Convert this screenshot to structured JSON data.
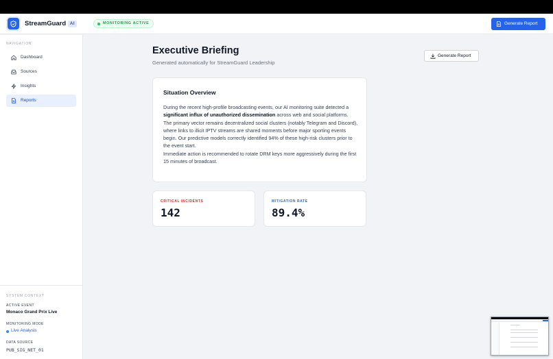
{
  "app": {
    "brand": "StreamGuard",
    "ai_badge": "AI",
    "status_pill": "MONITORING ACTIVE",
    "primary_button": "Generate Report",
    "accent_color": "#2563eb"
  },
  "sidebar": {
    "heading": "NAVIGATION",
    "items": [
      {
        "label": "Dashboard",
        "icon": "home-icon",
        "active": false
      },
      {
        "label": "Sources",
        "icon": "database-icon",
        "active": false
      },
      {
        "label": "Insights",
        "icon": "lightning-icon",
        "active": false
      },
      {
        "label": "Reports",
        "icon": "document-icon",
        "active": true
      }
    ],
    "context": {
      "heading": "SYSTEM CONTEXT",
      "active_event_label": "ACTIVE EVENT",
      "active_event": "Monaco Grand Prix Live",
      "mode_label": "MONITORING MODE",
      "mode": "Live Analysis",
      "source_label": "DATA SOURCE",
      "source": "PUB_SIG_NET_01"
    }
  },
  "main": {
    "title": "Executive Briefing",
    "subtitle": "Generated automatically for StreamGuard Leadership",
    "secondary_button": "Generate Report",
    "overview": {
      "heading": "Situation Overview",
      "p1_before": "During the recent high-profile broadcasting events, our AI monitoring suite detected a ",
      "p1_bold": "significant influx of unauthorized dissemination",
      "p1_after": " across web and social platforms.",
      "p2": "The primary vector remains decentralized social clusters (notably Telegram and Discord), where links to illicit IPTV streams are shared moments before major sporting events begin. Our predictive models correctly identified 94% of these high-risk clusters prior to the event start.",
      "p3": "Immediate action is recommended to rotate DRM keys more aggressively during the first 15 minutes of broadcast."
    },
    "stats": [
      {
        "label": "CRITICAL INCIDENTS",
        "value": "142",
        "color": "#dc2626"
      },
      {
        "label": "MITIGATION RATE",
        "value": "89.4%",
        "color": "#2563eb"
      }
    ]
  }
}
